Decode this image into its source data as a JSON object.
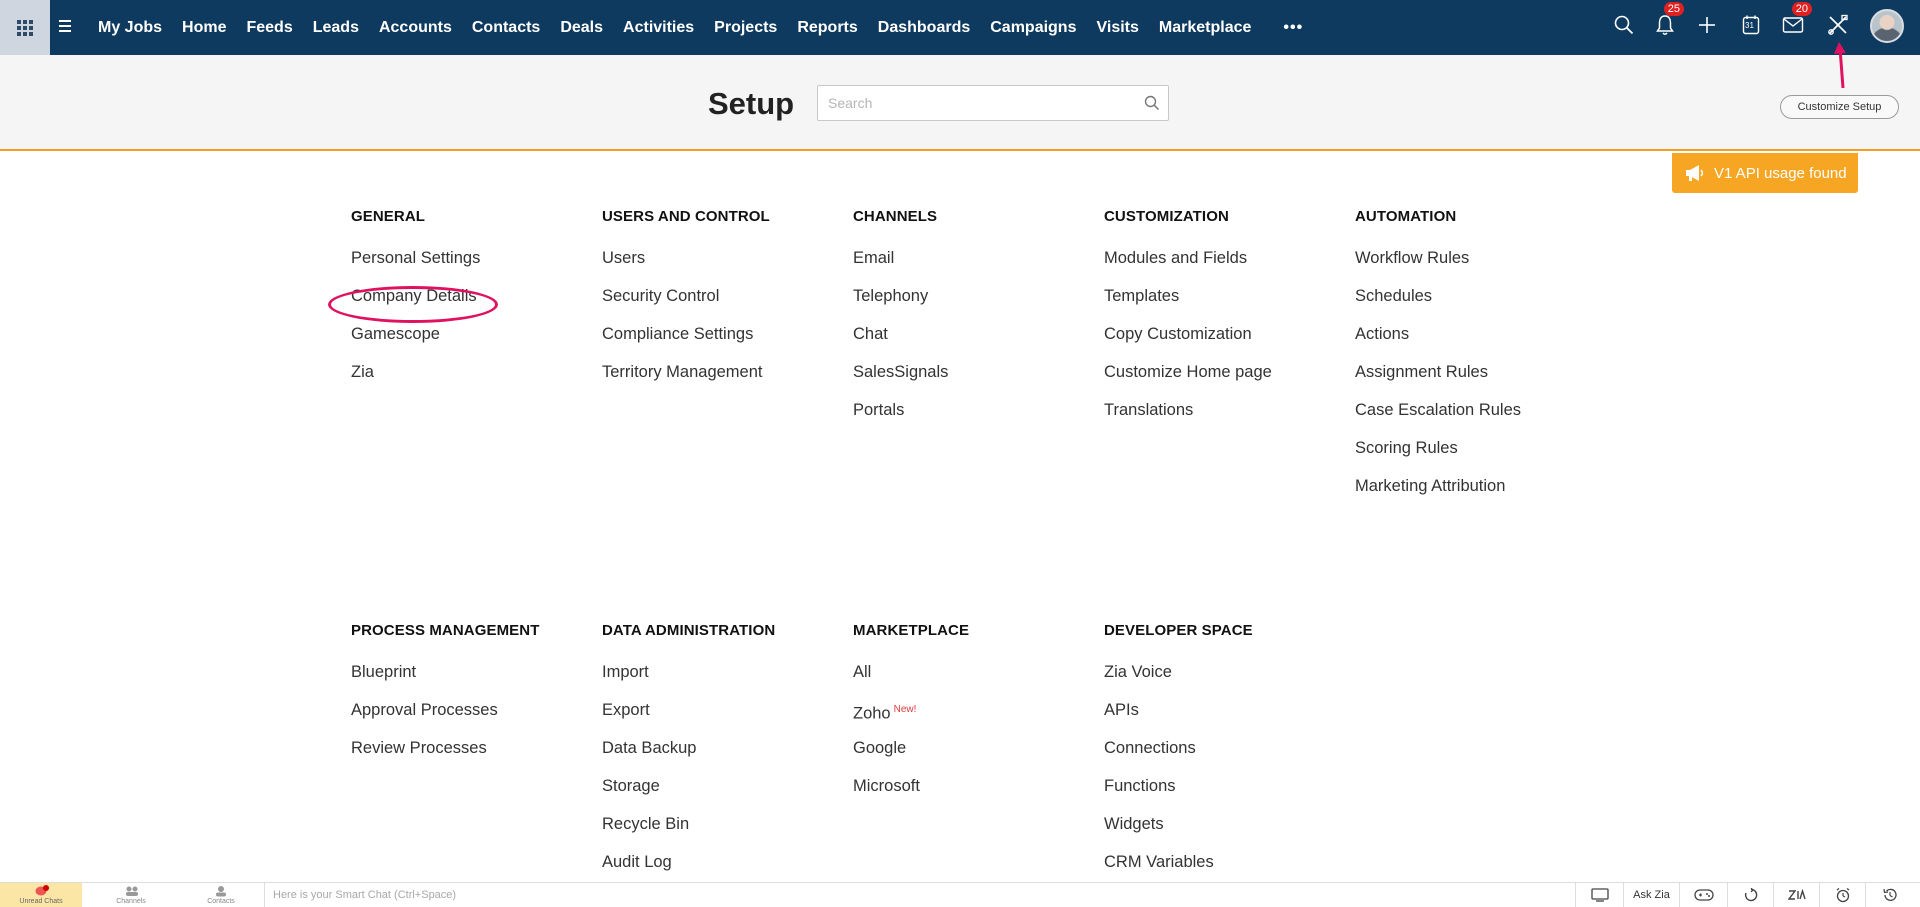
{
  "nav": {
    "tabs": [
      "My Jobs",
      "Home",
      "Feeds",
      "Leads",
      "Accounts",
      "Contacts",
      "Deals",
      "Activities",
      "Projects",
      "Reports",
      "Dashboards",
      "Campaigns",
      "Visits",
      "Marketplace"
    ],
    "more": "•••",
    "notifications_count": "25",
    "mail_count": "20",
    "calendar_day": "31"
  },
  "header": {
    "title": "Setup",
    "search_placeholder": "Search",
    "customize_label": "Customize Setup",
    "api_banner": "V1 API usage found"
  },
  "sections": [
    {
      "title": "GENERAL",
      "items": [
        "Personal Settings",
        "Company Details",
        "Gamescope",
        "Zia"
      ]
    },
    {
      "title": "USERS AND CONTROL",
      "items": [
        "Users",
        "Security Control",
        "Compliance Settings",
        "Territory Management"
      ]
    },
    {
      "title": "CHANNELS",
      "items": [
        "Email",
        "Telephony",
        "Chat",
        "SalesSignals",
        "Portals"
      ]
    },
    {
      "title": "CUSTOMIZATION",
      "items": [
        "Modules and Fields",
        "Templates",
        "Copy Customization",
        "Customize Home page",
        "Translations"
      ]
    },
    {
      "title": "AUTOMATION",
      "items": [
        "Workflow Rules",
        "Schedules",
        "Actions",
        "Assignment Rules",
        "Case Escalation Rules",
        "Scoring Rules",
        "Marketing Attribution"
      ]
    },
    {
      "title": "PROCESS MANAGEMENT",
      "items": [
        "Blueprint",
        "Approval Processes",
        "Review Processes"
      ]
    },
    {
      "title": "DATA ADMINISTRATION",
      "items": [
        "Import",
        "Export",
        "Data Backup",
        "Storage",
        "Recycle Bin",
        "Audit Log"
      ]
    },
    {
      "title": "MARKETPLACE",
      "items": [
        "All",
        "Zoho",
        "Google",
        "Microsoft"
      ],
      "new_label": "New!"
    },
    {
      "title": "DEVELOPER SPACE",
      "items": [
        "Zia Voice",
        "APIs",
        "Connections",
        "Functions",
        "Widgets",
        "CRM Variables"
      ]
    }
  ],
  "bottom": {
    "unread_chats": "Unread Chats",
    "channels": "Channels",
    "contacts": "Contacts",
    "smart_chat": "Here is your Smart Chat (Ctrl+Space)",
    "ask_zia": "Ask Zia"
  },
  "colors": {
    "nav_bg": "#0e3a5f",
    "accent_orange": "#f0a01e",
    "banner": "#f6a623",
    "highlight_pink": "#e0115f"
  }
}
